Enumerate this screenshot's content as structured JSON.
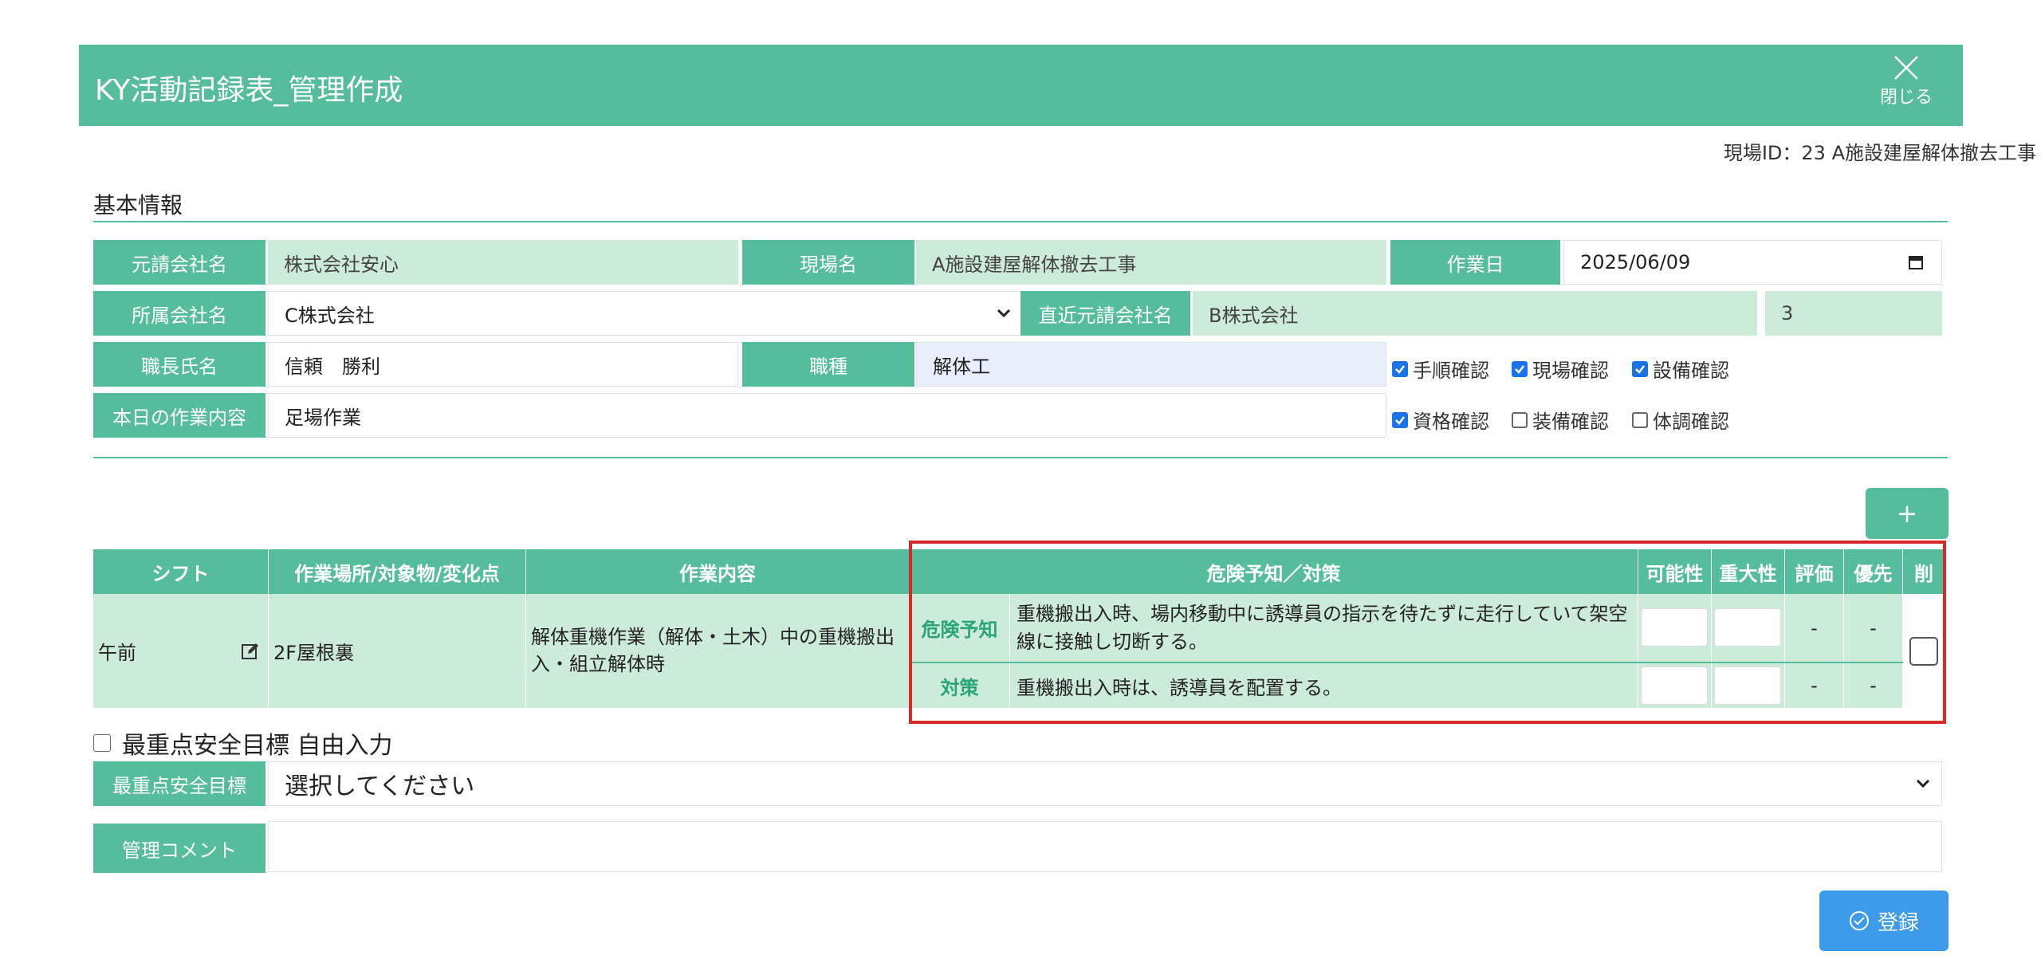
{
  "header": {
    "title": "KY活動記録表_管理作成",
    "close_label": "閉じる"
  },
  "site_id": "現場ID：23 A施設建屋解体撤去工事",
  "section_title": "基本情報",
  "basic": {
    "prime_contractor_label": "元請会社名",
    "prime_contractor_value": "株式会社安心",
    "site_name_label": "現場名",
    "site_name_value": "A施設建屋解体撤去工事",
    "work_date_label": "作業日",
    "work_date_value": "2025/06/09",
    "affiliation_label": "所属会社名",
    "affiliation_value": "C株式会社",
    "direct_prime_label": "直近元請会社名",
    "direct_prime_value": "B株式会社",
    "count_value": "3",
    "foreman_label": "職長氏名",
    "foreman_value": "信頼　勝利",
    "job_type_label": "職種",
    "job_type_value": "解体工",
    "today_work_label": "本日の作業内容",
    "today_work_value": "足場作業"
  },
  "checks": [
    {
      "label": "手順確認",
      "checked": true
    },
    {
      "label": "現場確認",
      "checked": true
    },
    {
      "label": "設備確認",
      "checked": true
    },
    {
      "label": "資格確認",
      "checked": true
    },
    {
      "label": "装備確認",
      "checked": false
    },
    {
      "label": "体調確認",
      "checked": false
    }
  ],
  "add_button_label": "+",
  "table": {
    "headers": [
      "シフト",
      "作業場所/対象物/変化点",
      "作業内容",
      "危険予知／対策",
      "可能性",
      "重大性",
      "評価",
      "優先",
      "削"
    ],
    "row": {
      "shift": "午前",
      "place": "2F屋根裏",
      "work": "解体重機作業（解体・土木）中の重機搬出入・組立解体時",
      "hazard_tag": "危険予知",
      "hazard_text": "重機搬出入時、場内移動中に誘導員の指示を待たずに走行していて架空線に接触し切断する。",
      "measure_tag": "対策",
      "measure_text": "重機搬出入時は、誘導員を配置する。",
      "hazard_eval": "-",
      "hazard_priority": "-",
      "measure_eval": "-",
      "measure_priority": "-"
    }
  },
  "free_input_label": "最重点安全目標 自由入力",
  "goal_label": "最重点安全目標",
  "goal_value": "選択してください",
  "comment_label": "管理コメント",
  "comment_value": "",
  "submit_label": "登録",
  "colors": {
    "primary": "#55bd9c",
    "readonly_bg": "#cdebd9",
    "highlight": "#d62a2a",
    "submit": "#3d9be9"
  }
}
